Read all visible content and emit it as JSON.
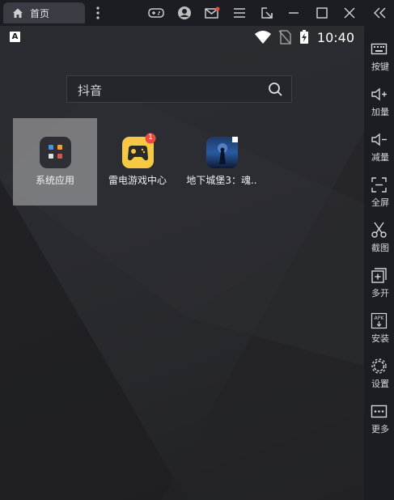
{
  "titlebar": {
    "tab_label": "首页",
    "icons": [
      "menu-dots-icon",
      "gamepad-icon",
      "account-icon",
      "mail-icon",
      "hamburger-icon",
      "external-link-icon",
      "minimize-icon",
      "maximize-icon",
      "close-icon",
      "collapse-sidebar-icon"
    ],
    "mail_badge_color": "#e84c3d"
  },
  "statusbar": {
    "time": "10:40",
    "keyboard_indicator": "A"
  },
  "search": {
    "placeholder": "抖音"
  },
  "apps": [
    {
      "label": "系统应用",
      "icon": "system-apps-folder-icon",
      "selected": true
    },
    {
      "label": "雷电游戏中心",
      "icon": "game-center-icon",
      "badge": "1"
    },
    {
      "label": "地下城堡3：魂..",
      "icon": "dungeon-castle-icon"
    }
  ],
  "sidebar": {
    "items": [
      {
        "label": "按键",
        "icon": "keyboard-icon"
      },
      {
        "label": "加量",
        "icon": "volume-up-icon"
      },
      {
        "label": "减量",
        "icon": "volume-down-icon"
      },
      {
        "label": "全屏",
        "icon": "fullscreen-icon"
      },
      {
        "label": "截图",
        "icon": "scissors-icon"
      },
      {
        "label": "多开",
        "icon": "multi-instance-icon"
      },
      {
        "label": "安装",
        "icon": "apk-install-icon"
      },
      {
        "label": "设置",
        "icon": "settings-gear-icon"
      },
      {
        "label": "更多",
        "icon": "more-icon"
      }
    ]
  },
  "colors": {
    "accent_yellow": "#f6c945",
    "badge_red": "#e84c3d",
    "background": "#2a2b30"
  }
}
